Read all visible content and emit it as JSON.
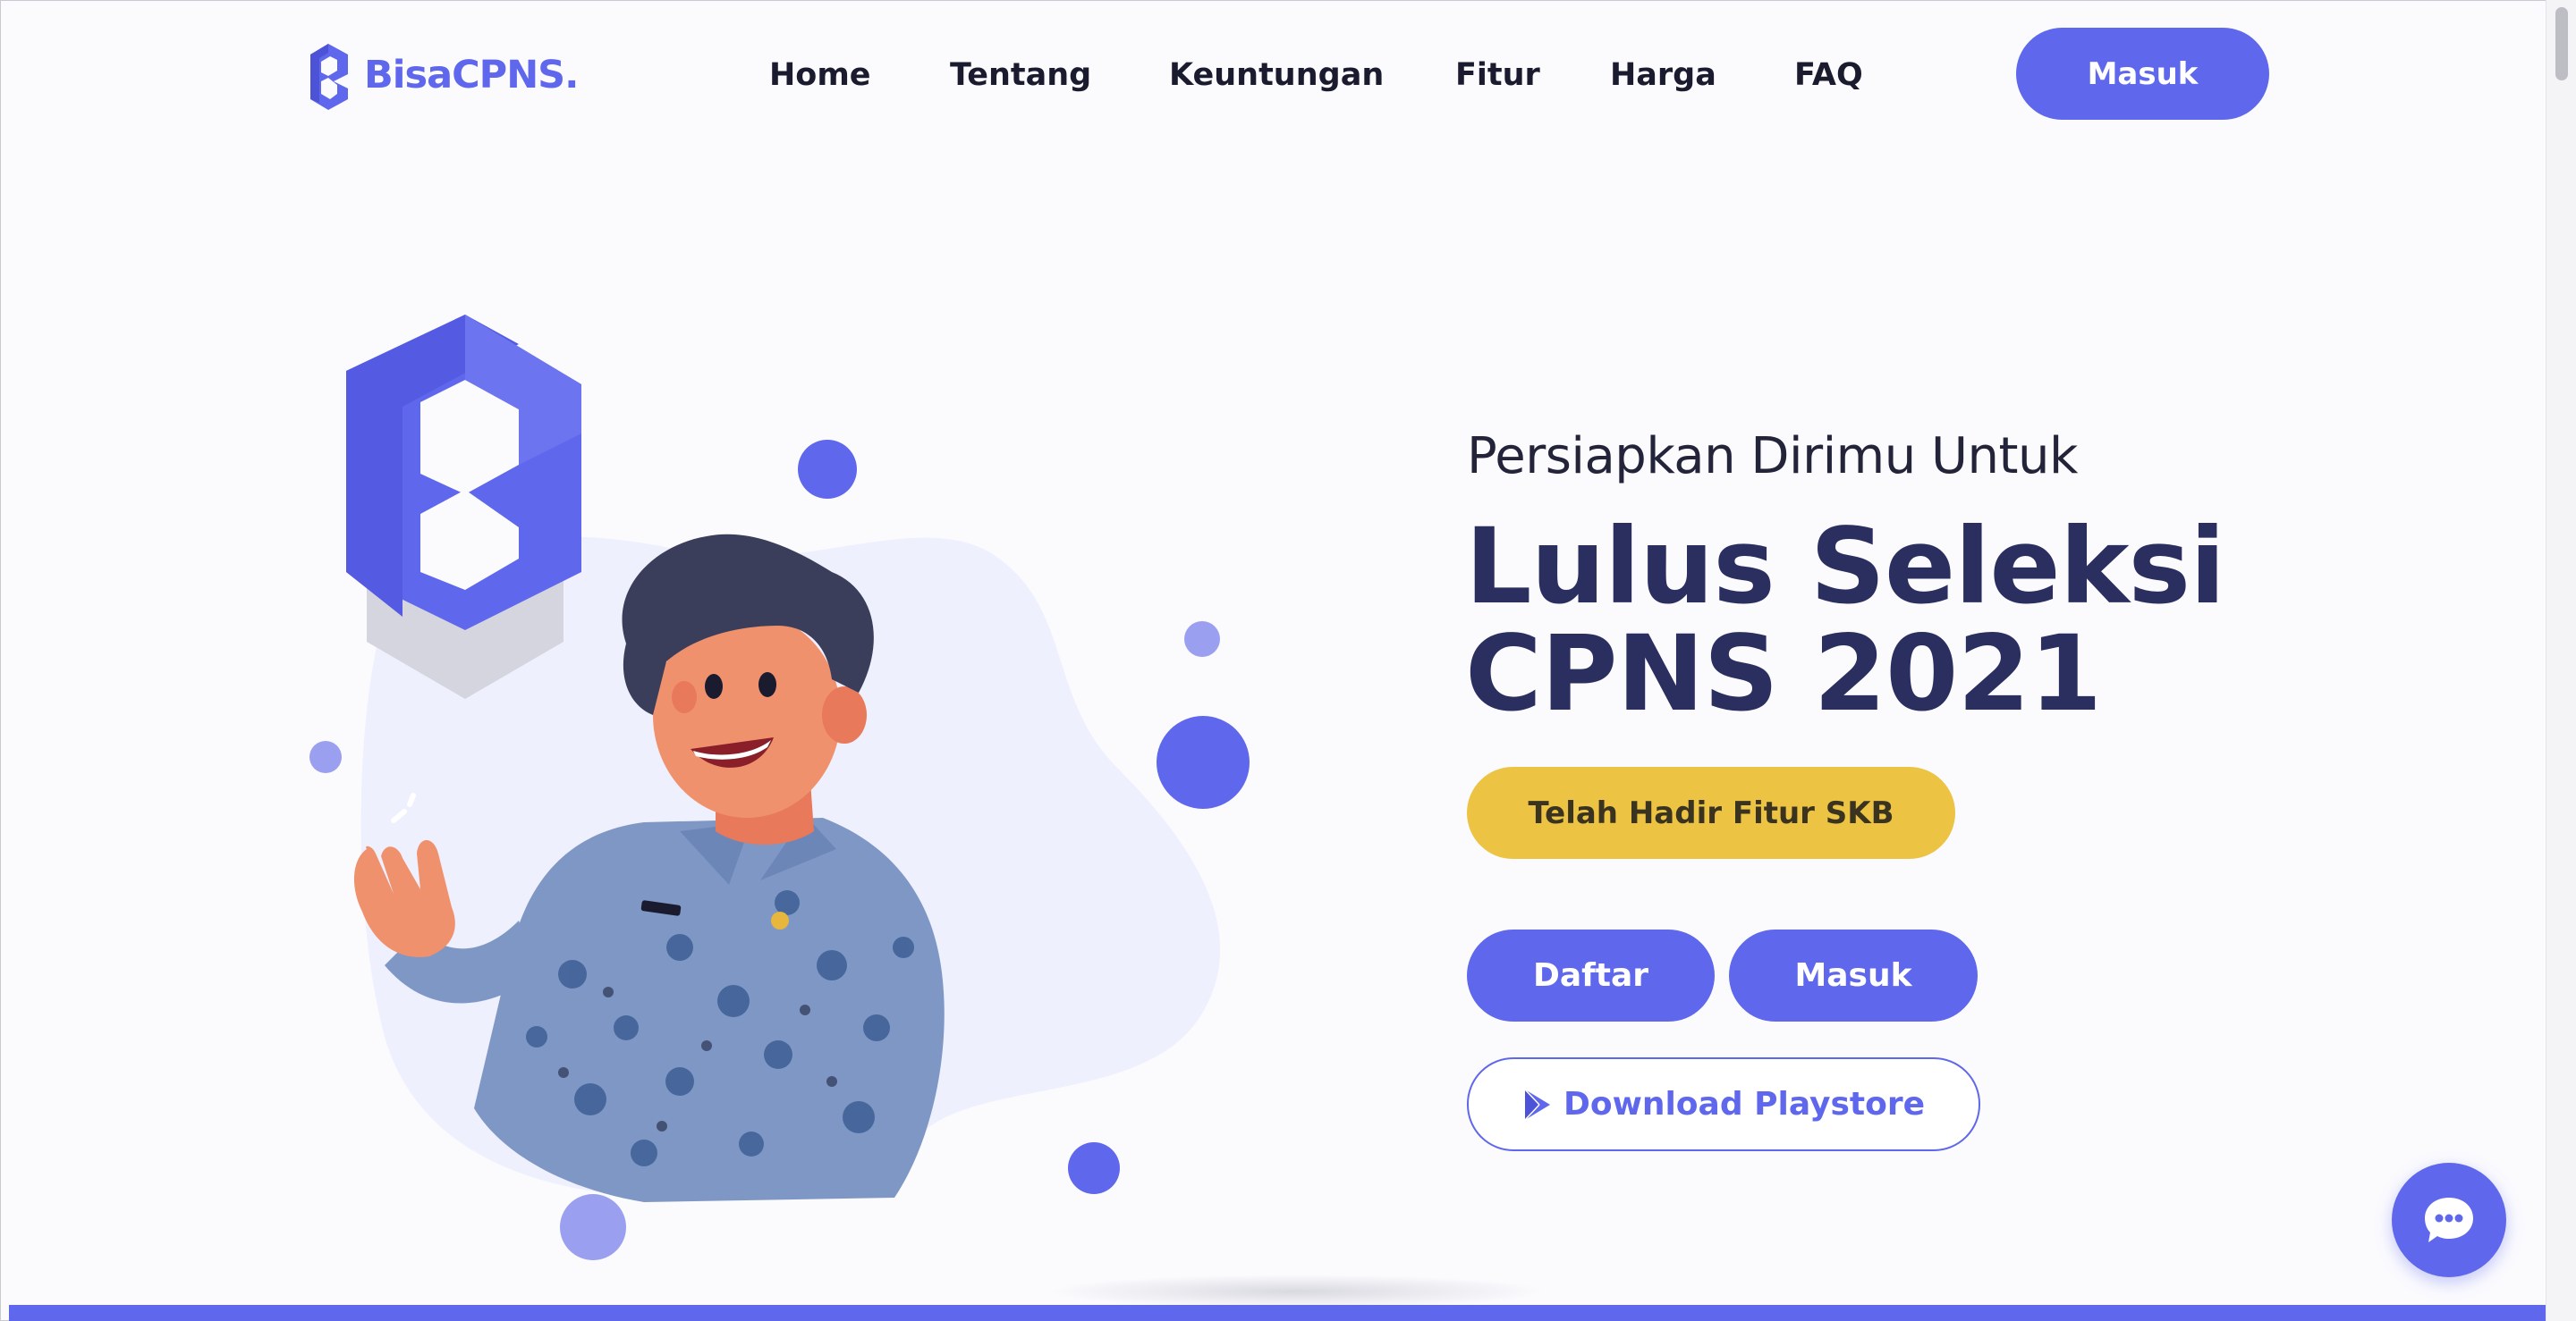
{
  "header": {
    "logo_text": "BisaCPNS.",
    "nav": [
      {
        "label": "Home"
      },
      {
        "label": "Tentang"
      },
      {
        "label": "Keuntungan"
      },
      {
        "label": "Fitur"
      },
      {
        "label": "Harga"
      },
      {
        "label": "FAQ"
      }
    ],
    "login_label": "Masuk"
  },
  "hero": {
    "subtitle": "Persiapkan Dirimu Untuk",
    "title": "Lulus Seleksi CPNS 2021",
    "badge_label": "Telah Hadir Fitur SKB",
    "register_label": "Daftar",
    "login_label": "Masuk",
    "playstore_label": "Download Playstore"
  },
  "colors": {
    "primary": "#5f67ec",
    "badge": "#ecc342",
    "title": "#2b2f60",
    "background": "#fbfbfe"
  },
  "icons": {
    "logo": "bisacpns-logo-icon",
    "playstore": "play-icon",
    "chat": "chat-bubble-icon"
  }
}
